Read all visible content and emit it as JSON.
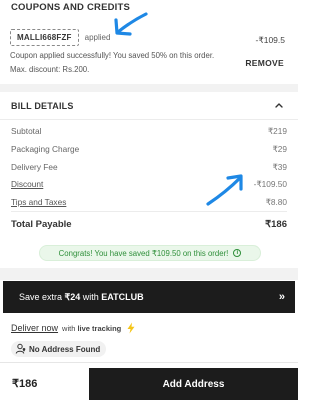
{
  "coupons": {
    "heading": "COUPONS AND CREDITS",
    "code": "MALLI668FZF",
    "status": "applied",
    "saving": "-₹109.5",
    "message": "Coupon applied successfully! You saved 50% on this order. Max. discount: Rs.200.",
    "remove_label": "REMOVE"
  },
  "bill": {
    "heading": "BILL DETAILS",
    "rows": [
      {
        "label": "Subtotal",
        "value": "₹219"
      },
      {
        "label": "Packaging Charge",
        "value": "₹29"
      },
      {
        "label": "Delivery Fee",
        "value": "₹39"
      },
      {
        "label": "Discount",
        "value": "-₹109.50"
      },
      {
        "label": "Tips and Taxes",
        "value": "₹8.80"
      }
    ],
    "total_label": "Total Payable",
    "total_value": "₹186",
    "savings_message": "Congrats! You have saved ₹109.50 on this order!"
  },
  "eatclub": {
    "prefix": "Save extra ",
    "amount": "₹24",
    "suffix": " with ",
    "brand": "EATCLUB",
    "chevron": "»"
  },
  "delivery": {
    "deliver_now": "Deliver now",
    "with_text": "with",
    "tracking": "live tracking",
    "address_chip": "No Address Found"
  },
  "footer": {
    "total": "₹186",
    "cta": "Add Address"
  },
  "colors": {
    "accent_dark": "#1c1c1c",
    "success_green": "#2f8f3a",
    "annotation_blue": "#1e88e5",
    "bolt_yellow": "#f5c518"
  },
  "icons": [
    "chevron-up-icon",
    "info-icon",
    "lightning-bolt-icon",
    "location-person-icon",
    "double-chevron-right-icon"
  ]
}
